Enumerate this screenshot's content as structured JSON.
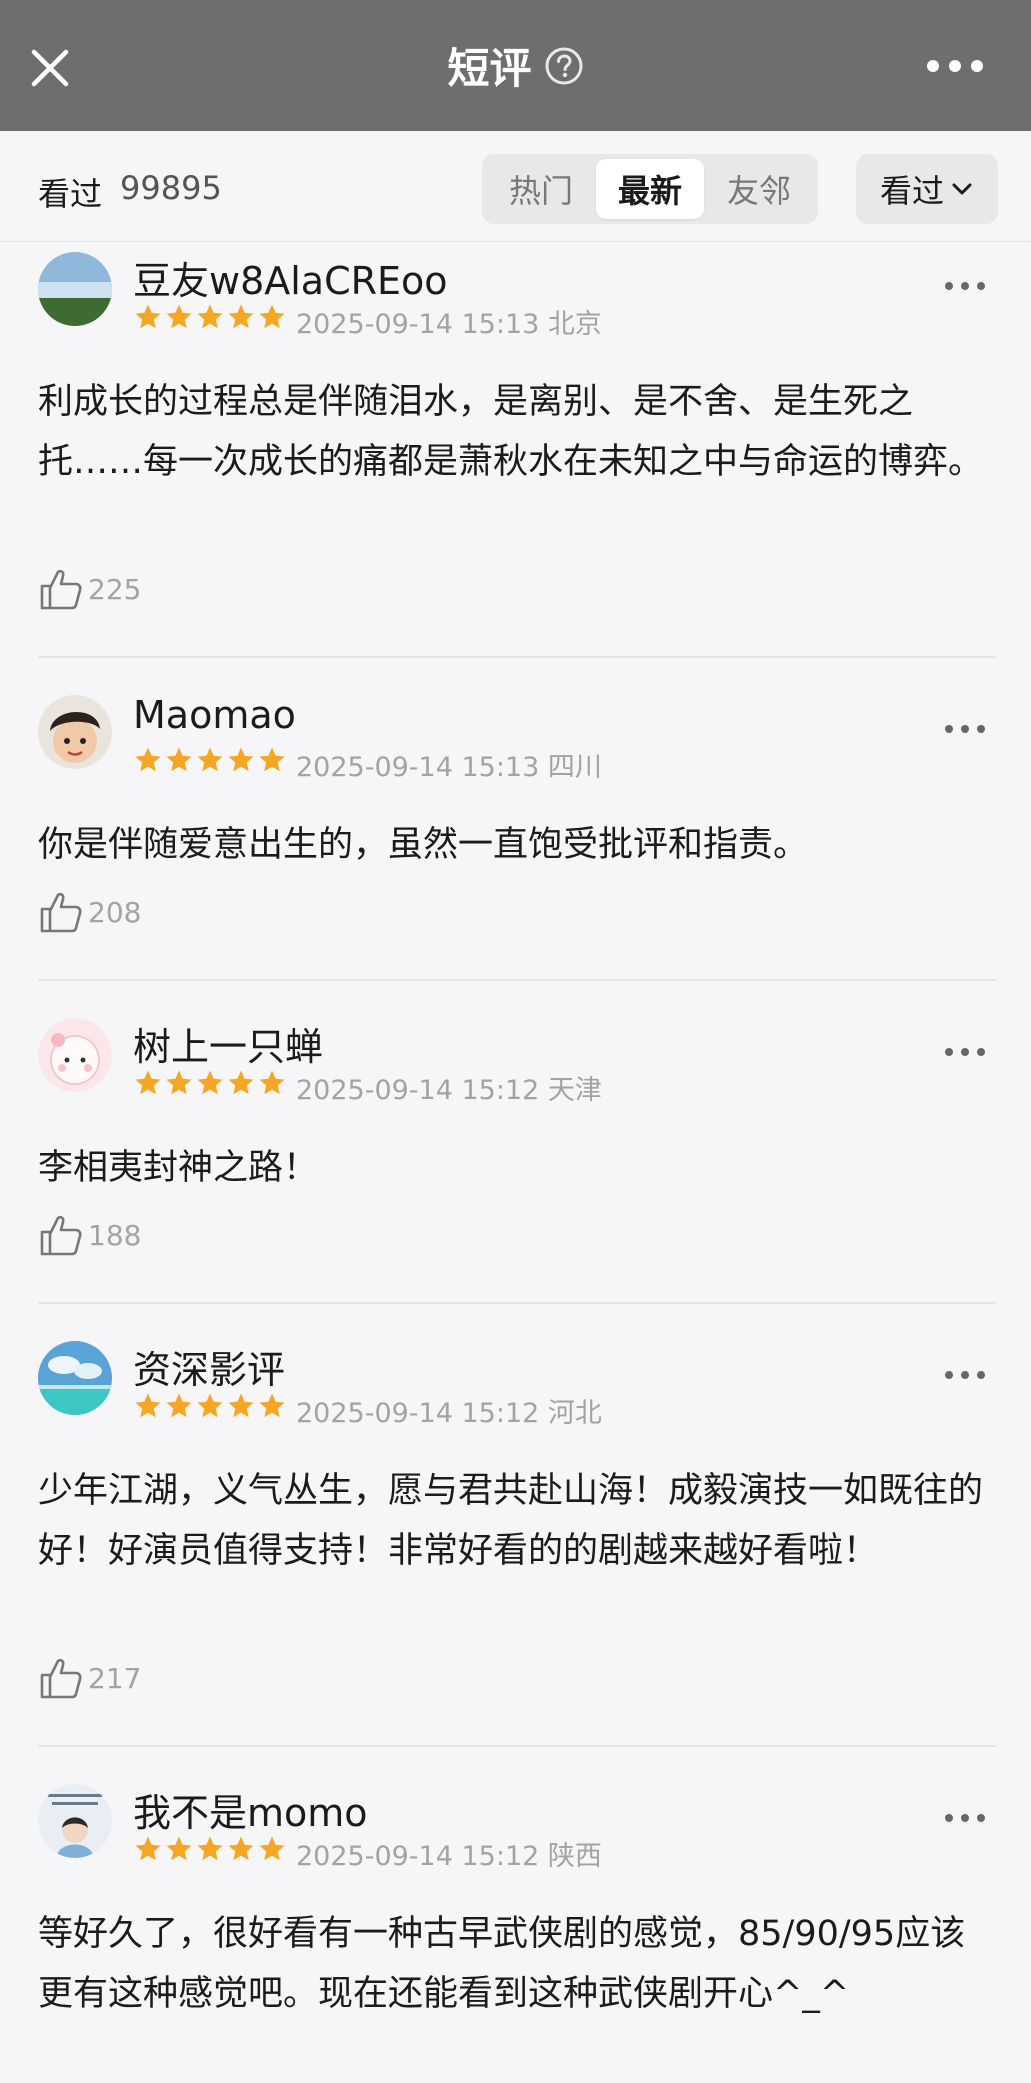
{
  "header": {
    "title": "短评",
    "icons": {
      "close": "close-icon",
      "help": "help-icon",
      "more": "more-icon"
    }
  },
  "subbar": {
    "seen_label": "看过",
    "seen_count": "99895",
    "tabs": [
      {
        "label": "热门",
        "active": false
      },
      {
        "label": "最新",
        "active": true
      },
      {
        "label": "友邻",
        "active": false
      }
    ],
    "filter_label": "看过"
  },
  "colors": {
    "header_bg": "#6e6e6e",
    "star": "#f5a623",
    "page_bg": "#f6f6f8"
  },
  "reviews": [
    {
      "name": "豆友w8AlaCREoo",
      "rating": 5,
      "time": "2025-09-14 15:13",
      "location": "北京",
      "text": "利成长的过程总是伴随泪水，是离别、是不舍、是生死之托……每一次成长的痛都是萧秋水在未知之中与命运的博弈。",
      "likes": "225"
    },
    {
      "name": "Maomao",
      "rating": 5,
      "time": "2025-09-14 15:13",
      "location": "四川",
      "text": "你是伴随爱意出生的，虽然一直饱受批评和指责。",
      "likes": "208"
    },
    {
      "name": "树上一只蝉",
      "rating": 5,
      "time": "2025-09-14 15:12",
      "location": "天津",
      "text": "李相夷封神之路！",
      "likes": "188"
    },
    {
      "name": "资深影评",
      "rating": 5,
      "time": "2025-09-14 15:12",
      "location": "河北",
      "text": "少年江湖，义气丛生，愿与君共赴山海！成毅演技一如既往的好！好演员值得支持！非常好看的的剧越来越好看啦！",
      "likes": "217"
    },
    {
      "name": "我不是momo",
      "rating": 5,
      "time": "2025-09-14 15:12",
      "location": "陕西",
      "text": "等好久了，很好看有一种古早武侠剧的感觉，85/90/95应该更有这种感觉吧。现在还能看到这种武侠剧开心^_^",
      "likes": ""
    }
  ]
}
